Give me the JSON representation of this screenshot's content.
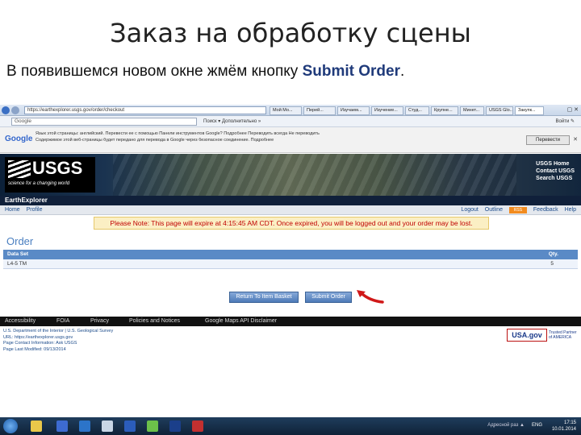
{
  "slide": {
    "title": "Заказ на обработку сцены",
    "caption_prefix": "В появившемся новом окне жмём кнопку ",
    "caption_button": "Submit Order",
    "caption_suffix": "."
  },
  "browser": {
    "url": "https://earthexplorer.usgs.gov/order/checkout",
    "tabs": [
      "Мой Мо...",
      "Перей...",
      "Изучаем...",
      "Изучение...",
      "Студ...",
      "Крупне...",
      "Минет...",
      "USGS Glo...",
      "Закупк..."
    ],
    "search_placeholder": "Google",
    "toolbar_items": "Поиск ▾   Дополнительно »",
    "toolbar_right": "Войти ✎"
  },
  "translate_bar": {
    "logo": "Google",
    "line1": "Язык этой страницы: английский. Перевести ее с помощью Панели инструментов Google? Подробнее   Переводить всегда  Не переводить",
    "line2": "Содержимое этой веб-страницы будет передано для перевода в Google через безопасное соединение.  Подробнее",
    "line3": "",
    "button": "Перевести",
    "close": "✕"
  },
  "header": {
    "logo_text": "USGS",
    "slogan": "science for a changing world",
    "links": [
      "USGS Home",
      "Contact USGS",
      "Search USGS"
    ],
    "app_name": "EarthExplorer"
  },
  "nav": {
    "left": [
      "Home",
      "Profile"
    ],
    "right": [
      "Logout",
      "Outline",
      "Feedback",
      "Help"
    ],
    "rss": "RSS"
  },
  "notice": "Please Note: This page will expire at 4:15:45 AM CDT. Once expired, you will be logged out and your order may be lost.",
  "order": {
    "heading": "Order",
    "columns": [
      "Data Set",
      "Qty."
    ],
    "rows": [
      {
        "dataset": "L4-5 TM",
        "qty": "5"
      }
    ]
  },
  "buttons": {
    "return": "Return To Item Basket",
    "submit": "Submit Order"
  },
  "footer": {
    "links": [
      "Accessibility",
      "FOIA",
      "Privacy",
      "Policies and Notices",
      "Google Maps API Disclaimer"
    ],
    "info": [
      "U.S. Department of the Interior | U.S. Geological Survey",
      "URL: https://earthexplorer.usgs.gov",
      "Page Contact Information: Ask USGS",
      "Page Last Modified: 09/13/2014"
    ],
    "usagov": "USA.gov",
    "usagov_sub": "Trusted Partner of AMERICA"
  },
  "taskbar": {
    "time": "17:15",
    "date": "10.01.2014",
    "lang": "ENG",
    "tray": "Адресной раз ▲"
  }
}
